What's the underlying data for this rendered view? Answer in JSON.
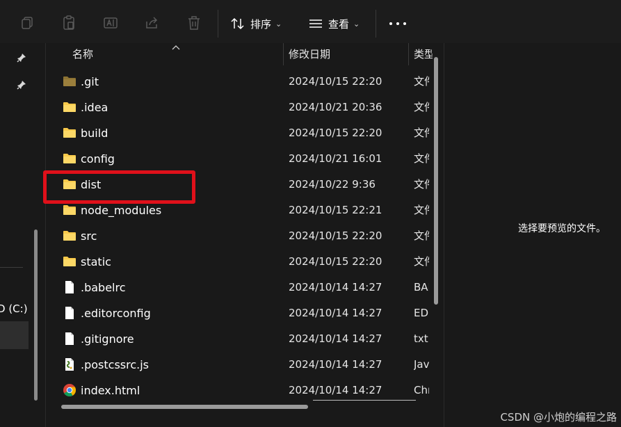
{
  "toolbar": {
    "icons": [
      "copy-icon",
      "paste-icon",
      "rename-icon",
      "share-icon",
      "delete-icon"
    ],
    "sort_label": "排序",
    "view_label": "查看",
    "more_icon": "more-icon"
  },
  "nav": {
    "drive_label": "D (C:)"
  },
  "columns": {
    "name": "名称",
    "modified": "修改日期",
    "type": "类型"
  },
  "files": [
    {
      "name": ".git",
      "date": "2024/10/15 22:20",
      "type": "文件夹",
      "icon": "folder-icon-dim"
    },
    {
      "name": ".idea",
      "date": "2024/10/21 20:36",
      "type": "文件夹",
      "icon": "folder-icon"
    },
    {
      "name": "build",
      "date": "2024/10/15 22:20",
      "type": "文件夹",
      "icon": "folder-icon"
    },
    {
      "name": "config",
      "date": "2024/10/21 16:01",
      "type": "文件夹",
      "icon": "folder-icon"
    },
    {
      "name": "dist",
      "date": "2024/10/22 9:36",
      "type": "文件夹",
      "icon": "folder-icon"
    },
    {
      "name": "node_modules",
      "date": "2024/10/15 22:21",
      "type": "文件夹",
      "icon": "folder-icon"
    },
    {
      "name": "src",
      "date": "2024/10/15 22:20",
      "type": "文件夹",
      "icon": "folder-icon"
    },
    {
      "name": "static",
      "date": "2024/10/15 22:20",
      "type": "文件夹",
      "icon": "folder-icon"
    },
    {
      "name": ".babelrc",
      "date": "2024/10/14 14:27",
      "type": "BAB",
      "icon": "file-icon"
    },
    {
      "name": ".editorconfig",
      "date": "2024/10/14 14:27",
      "type": "EDI",
      "icon": "file-icon"
    },
    {
      "name": ".gitignore",
      "date": "2024/10/14 14:27",
      "type": "txt",
      "icon": "file-icon"
    },
    {
      "name": ".postcssrc.js",
      "date": "2024/10/14 14:27",
      "type": "Jav",
      "icon": "js-file-icon"
    },
    {
      "name": "index.html",
      "date": "2024/10/14 14:27",
      "type": "Chr",
      "icon": "chrome-icon"
    }
  ],
  "preview": {
    "message": "选择要预览的文件。"
  },
  "watermark": "CSDN @小炮的编程之路",
  "colors": {
    "background": "#191919",
    "folder": "#f8c94a",
    "highlight": "#e0101a"
  }
}
